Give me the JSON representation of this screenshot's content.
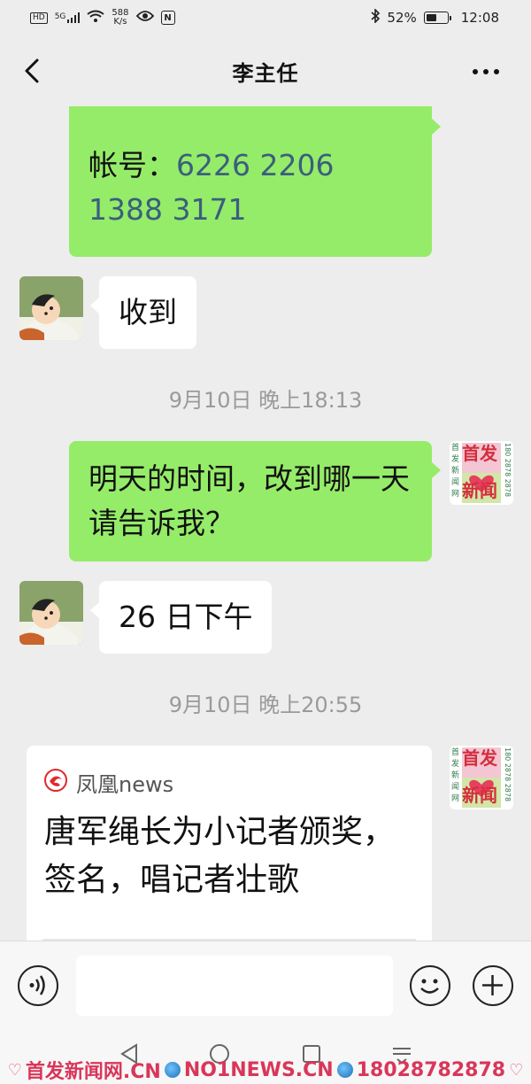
{
  "status_bar": {
    "hd": "HD",
    "signal": "5G",
    "net_speed_value": "588",
    "net_speed_unit": "K/s",
    "nfc": "N",
    "battery": "52%",
    "battery_level": 0.52,
    "time": "12:08"
  },
  "header": {
    "title": "李主任"
  },
  "messages": [
    {
      "side": "right",
      "label": "帐号：",
      "account": "6226 2206 1388 3171"
    },
    {
      "side": "left",
      "text": "收到"
    },
    {
      "type": "timestamp",
      "text": "9月10日 晚上18:13"
    },
    {
      "side": "right",
      "text": "明天的时间，改到哪一天请告诉我？"
    },
    {
      "side": "left",
      "text": "26 日下午"
    },
    {
      "type": "timestamp",
      "text": "9月10日 晚上20:55"
    },
    {
      "side": "right",
      "type": "link",
      "source": "凤凰news",
      "headline": "唐军绳长为小记者颁奖，签名，唱记者壮歌"
    }
  ],
  "sender_avatar": {
    "text_1": "首发",
    "text_2": "新闻",
    "side_vertical": "首发新闻网",
    "side_numbers": "180 2878 2878"
  },
  "watermark": {
    "part1": "首发新闻网.CN",
    "part2": "NO1NEWS.CN",
    "part3": "18028782878"
  },
  "colors": {
    "background": "#ededed",
    "bubble_sent": "#95ec69",
    "bubble_received": "#ffffff",
    "account_number": "#3a5f7d",
    "timestamp": "#9a9a9a",
    "watermark": "#d9365a"
  }
}
